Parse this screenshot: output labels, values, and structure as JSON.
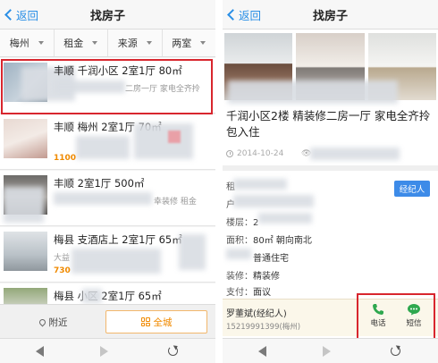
{
  "left": {
    "back_label": "返回",
    "title": "找房子",
    "filters": [
      {
        "label": "梅州"
      },
      {
        "label": "租金"
      },
      {
        "label": "来源"
      },
      {
        "label": "两室"
      }
    ],
    "listings": [
      {
        "title": "丰顺 千润小区 2室1厅 80㎡",
        "sub": "二房一厅 家电全齐拎",
        "price": ""
      },
      {
        "title": "丰顺 梅州 2室1厅 70㎡",
        "sub": "",
        "price": "1100"
      },
      {
        "title": "丰顺 2室1厅 500㎡",
        "sub": "幸装修 租金",
        "price": ""
      },
      {
        "title": "梅县 支酒店上 2室1厅 65㎡",
        "sub": "大益",
        "price": "730"
      },
      {
        "title": "梅县 小区 2室1厅 65㎡",
        "sub": "",
        "price": ""
      }
    ],
    "tab_near": "附近",
    "tab_city": "全城"
  },
  "right": {
    "back_label": "返回",
    "title": "找房子",
    "detail_title": "千润小区2楼 精装修二房一厅 家电全齐拎包入住",
    "date": "2014-10-24",
    "agent_button": "经纪人",
    "info": [
      {
        "key": "租",
        "value": ""
      },
      {
        "key": "户",
        "value": ""
      },
      {
        "key": "楼层：",
        "value": "2"
      },
      {
        "key": "面积：",
        "value": "80㎡  朝向南北"
      },
      {
        "key": "",
        "value": "普通住宅"
      },
      {
        "key": "装修：",
        "value": "精装修"
      },
      {
        "key": "支付：",
        "value": "面议"
      }
    ],
    "contact_name": "罗董斌(经纪人)",
    "contact_phone": "15219991399(梅州)",
    "call_label": "电话",
    "sms_label": "短信"
  },
  "colors": {
    "accent": "#2a8fe6",
    "price": "#f08a00",
    "highlight": "#d8262e",
    "call_green": "#2fa84f"
  }
}
